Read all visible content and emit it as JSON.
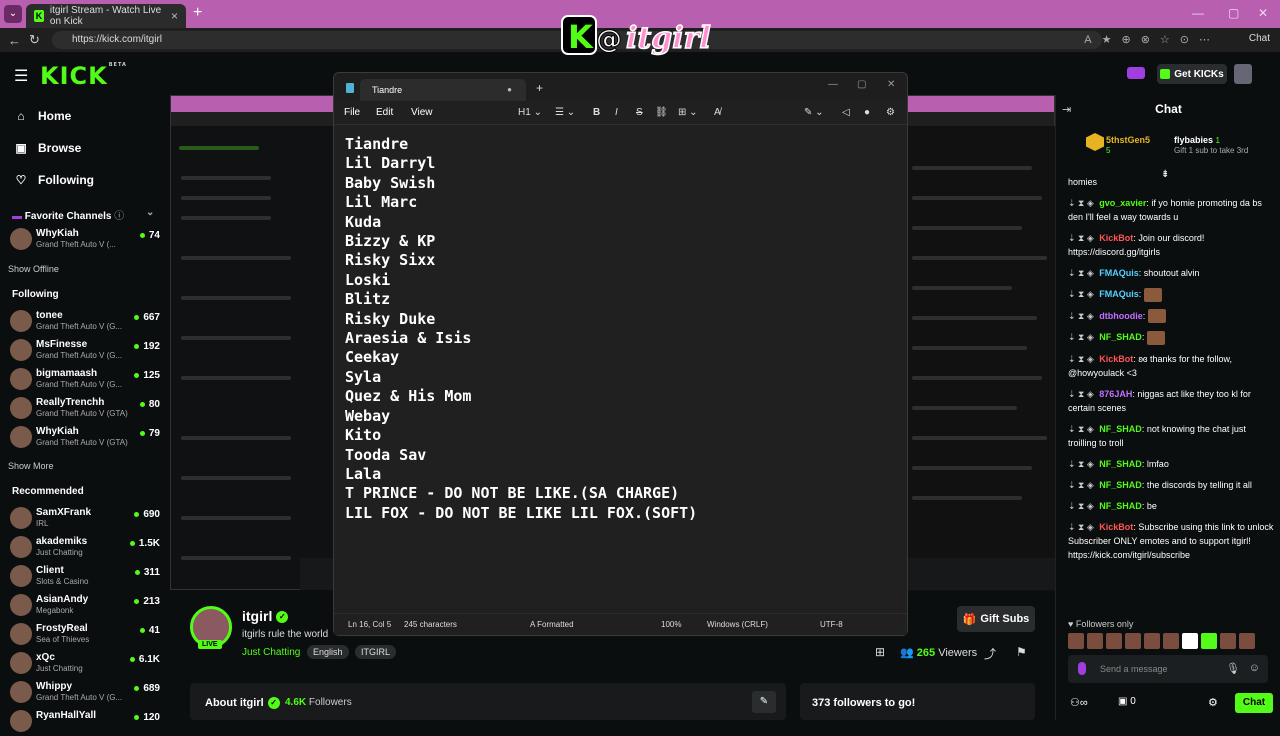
{
  "browser": {
    "tab_title": "itgirl Stream - Watch Live on Kick",
    "url": "https://kick.com/itgirl",
    "copilot_label": "Chat"
  },
  "overlay_logo_text": "K@itgirl",
  "sidebar": {
    "logo": "KICK",
    "beta": "BETA",
    "nav": [
      {
        "label": "Home",
        "icon": "home-icon"
      },
      {
        "label": "Browse",
        "icon": "browse-icon"
      },
      {
        "label": "Following",
        "icon": "heart-icon"
      }
    ],
    "favorite_title": "Favorite Channels",
    "favorites": [
      {
        "name": "WhyKiah",
        "game": "Grand Theft Auto V (...",
        "count": "74"
      }
    ],
    "show_offline": "Show Offline",
    "following_title": "Following",
    "following": [
      {
        "name": "tonee",
        "game": "Grand Theft Auto V (G...",
        "count": "667"
      },
      {
        "name": "MsFinesse",
        "game": "Grand Theft Auto V (G...",
        "count": "192"
      },
      {
        "name": "bigmamaash",
        "game": "Grand Theft Auto V (G...",
        "count": "125"
      },
      {
        "name": "ReallyTrenchh",
        "game": "Grand Theft Auto V (GTA)",
        "count": "80"
      },
      {
        "name": "WhyKiah",
        "game": "Grand Theft Auto V (GTA)",
        "count": "79"
      }
    ],
    "show_more": "Show More",
    "recommended_title": "Recommended",
    "recommended": [
      {
        "name": "SamXFrank",
        "game": "IRL",
        "count": "690"
      },
      {
        "name": "akademiks",
        "game": "Just Chatting",
        "count": "1.5K"
      },
      {
        "name": "Client",
        "game": "Slots & Casino",
        "count": "311"
      },
      {
        "name": "AsianAndy",
        "game": "Megabonk",
        "count": "213"
      },
      {
        "name": "FrostyReal",
        "game": "Sea of Thieves",
        "count": "41"
      },
      {
        "name": "xQc",
        "game": "Just Chatting",
        "count": "6.1K"
      },
      {
        "name": "Whippy",
        "game": "Grand Theft Auto V (G...",
        "count": "689"
      },
      {
        "name": "RyanHallYall",
        "game": "",
        "count": "120"
      }
    ]
  },
  "header": {
    "get_kicks": "Get KICKs"
  },
  "stream": {
    "live": "LIVE",
    "name": "itgirl",
    "title": "itgirls rule the world",
    "category": "Just Chatting",
    "tags": [
      "English",
      "ITGIRL"
    ],
    "gift_subs": "Gift Subs",
    "viewers_count": "265",
    "viewers_label": "Viewers",
    "about": "About itgirl",
    "followers_count": "4.6K",
    "followers_label": "Followers",
    "followers_goal": "373 followers to go!"
  },
  "notepad": {
    "tab_title": "Tiandre",
    "menu": [
      "File",
      "Edit",
      "View"
    ],
    "heading_tool": "H1",
    "lines": [
      "Tiandre",
      "Lil Darryl",
      "Baby Swish",
      "Lil Marc",
      "Kuda",
      "Bizzy & KP",
      "Risky Sixx",
      "Loski",
      "Blitz",
      "Risky Duke",
      "Araesia & Isis",
      "Ceekay",
      "Syla",
      "Quez & His Mom",
      "Webay",
      "Kito",
      "Tooda Sav",
      "Lala",
      "T PRINCE - DO NOT BE LIKE.(SA CHARGE)",
      "LIL FOX - DO NOT BE LIKE LIL FOX.(SOFT)"
    ],
    "status": {
      "position": "Ln 16, Col 5",
      "chars": "245 characters",
      "format": "Formatted",
      "zoom": "100%",
      "line_endings": "Windows (CRLF)",
      "encoding": "UTF-8"
    }
  },
  "chat": {
    "title": "Chat",
    "leader1": {
      "name": "5thstGen5",
      "count": "5"
    },
    "leader2": {
      "name": "flybabies",
      "count": "1",
      "note": "Gift 1 sub to take 3rd"
    },
    "messages": [
      {
        "user": "",
        "text": "homies",
        "color": "#ffffff"
      },
      {
        "user": "gvo_xavier",
        "text": ": if yo homie promoting da bs den I'll feel a way towards u",
        "color": "#53fc18"
      },
      {
        "user": "KickBot",
        "text": ": Join our discord! https://discord.gg/itgirls",
        "color": "#ff5555"
      },
      {
        "user": "FMAQuis",
        "text": ": shoutout alvin",
        "color": "#55d0ff"
      },
      {
        "user": "FMAQuis",
        "text": ":",
        "color": "#55d0ff"
      },
      {
        "user": "dtbhoodie",
        "text": ":",
        "color": "#c070ff"
      },
      {
        "user": "NF_SHAD",
        "text": ":",
        "color": "#53fc18"
      },
      {
        "user": "KickBot",
        "text": ": ʚɞ thanks for the follow, @howyoulack <3",
        "color": "#ff5555"
      },
      {
        "user": "876JAH",
        "text": ": niggas act like they too kl for certain scenes",
        "color": "#c070ff"
      },
      {
        "user": "NF_SHAD",
        "text": ": not knowing the chat just troilling to troll",
        "color": "#53fc18"
      },
      {
        "user": "NF_SHAD",
        "text": ": lmfao",
        "color": "#53fc18"
      },
      {
        "user": "NF_SHAD",
        "text": ": the discords by telling it all",
        "color": "#53fc18"
      },
      {
        "user": "NF_SHAD",
        "text": ": be",
        "color": "#53fc18"
      },
      {
        "user": "KickBot",
        "text": ": Subscribe using this link to unlock Subscriber ONLY emotes and to support itgirl! https://kick.com/itgirl/subscribe",
        "color": "#ff5555"
      }
    ],
    "followers_only": "Followers only",
    "send_placeholder": "Send a message",
    "kicks_count": "0",
    "chat_button": "Chat"
  }
}
